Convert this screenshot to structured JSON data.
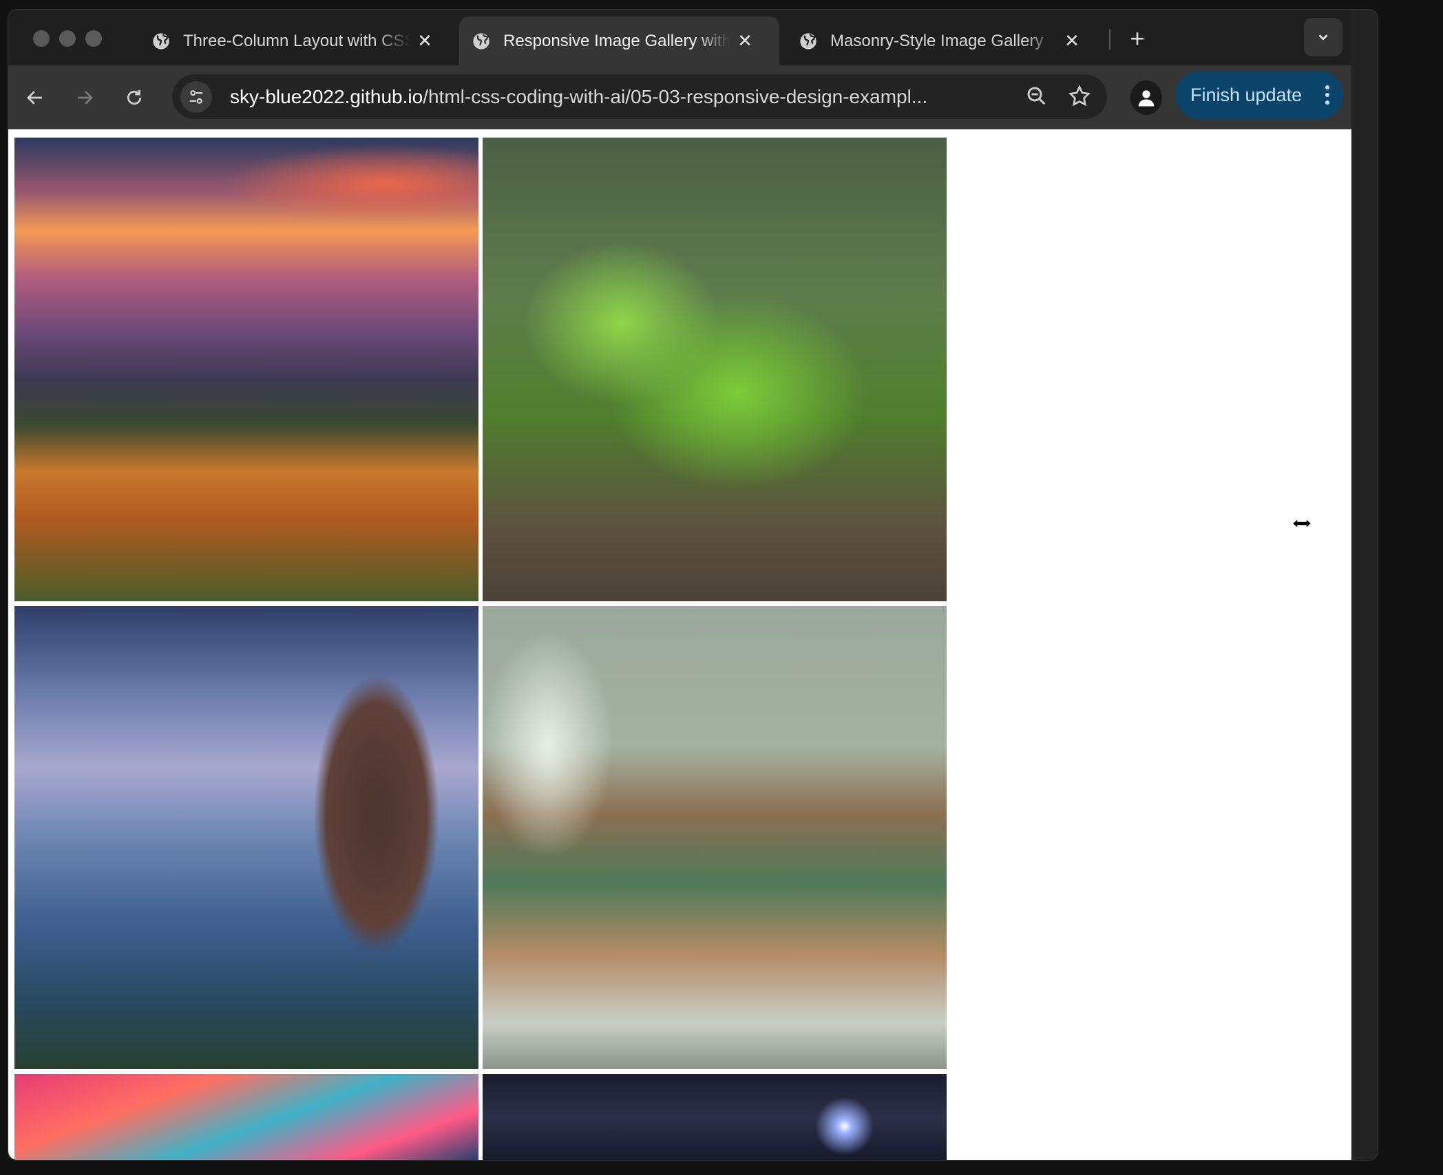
{
  "browser": {
    "tabs": [
      {
        "title": "Three-Column Layout with CSS",
        "active": false,
        "icon": "globe-icon"
      },
      {
        "title": "Responsive Image Gallery with",
        "active": true,
        "icon": "globe-icon"
      },
      {
        "title": "Masonry-Style Image Gallery",
        "active": false,
        "icon": "globe-icon"
      }
    ],
    "new_tab_label": "+",
    "close_glyph": "✕",
    "address": {
      "host": "sky-blue2022.github.io",
      "path": "/html-css-coding-with-ai/05-03-responsive-design-exampl..."
    },
    "finish_update_label": "Finish update",
    "accent_color": "#0b4468"
  },
  "gallery": {
    "images": [
      {
        "subject": "mountain-sunset",
        "alt": ""
      },
      {
        "subject": "green-salad",
        "alt": ""
      },
      {
        "subject": "hawk-on-branch",
        "alt": ""
      },
      {
        "subject": "green-cafe-interior",
        "alt": ""
      },
      {
        "subject": "pink-sky",
        "alt": ""
      },
      {
        "subject": "starry-space",
        "alt": ""
      }
    ]
  },
  "cursor": "resize-horizontal-cursor"
}
